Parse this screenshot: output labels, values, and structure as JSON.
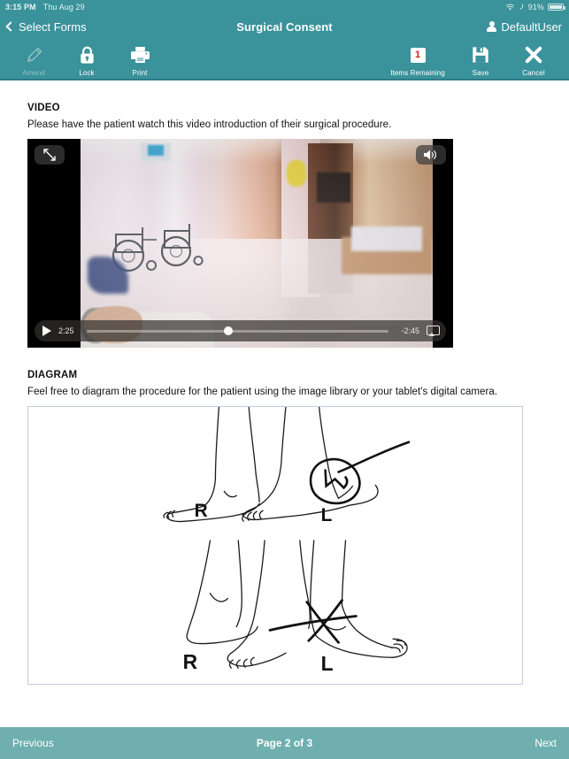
{
  "statusbar": {
    "time": "3:15 PM",
    "date": "Thu Aug 29",
    "battery_percent": "91%",
    "wifi_icon": "wifi-icon",
    "bluetooth_icon": "bluetooth-icon",
    "battery_icon": "battery-icon"
  },
  "navbar": {
    "back_label": "Select Forms",
    "title": "Surgical Consent",
    "user": "DefaultUser"
  },
  "toolbar": {
    "left": [
      {
        "label": "Amend",
        "icon": "pencil-icon",
        "disabled": true
      },
      {
        "label": "Lock",
        "icon": "lock-icon",
        "disabled": false
      },
      {
        "label": "Print",
        "icon": "printer-icon",
        "disabled": false
      }
    ],
    "right": [
      {
        "label": "Items Remaining",
        "icon": "count-badge-icon",
        "count": "1",
        "disabled": false
      },
      {
        "label": "Save",
        "icon": "floppy-disk-icon",
        "disabled": false
      },
      {
        "label": "Cancel",
        "icon": "close-x-icon",
        "disabled": false
      }
    ]
  },
  "video_section": {
    "title": "VIDEO",
    "description": "Please have the patient watch this video introduction of their surgical procedure.",
    "expand_icon": "fullscreen-arrows-icon",
    "volume_icon": "speaker-volume-icon",
    "play_icon": "play-icon",
    "elapsed": "2:25",
    "remaining": "-2:45",
    "progress_percent": 47,
    "airplay_icon": "airplay-icon"
  },
  "diagram_section": {
    "title": "DIAGRAM",
    "description": "Feel free to diagram the procedure for the patient using the image library or your tablet's digital camera.",
    "top_image": {
      "label_right_foot": "R",
      "label_left_foot": "L",
      "annotation": "circle-with-leader-line"
    },
    "bottom_image": {
      "label_right_foot": "R",
      "label_left_foot": "L",
      "annotation": "x-mark"
    }
  },
  "bottombar": {
    "previous": "Previous",
    "page": "Page 2 of 3",
    "next": "Next"
  },
  "colors": {
    "navbar_teal": "#3a929b",
    "bottombar_teal": "#6fafaf",
    "toolbar_divider": "#2e7d86",
    "badge_red": "#cc2020",
    "diagram_border": "#c5cbe0"
  }
}
